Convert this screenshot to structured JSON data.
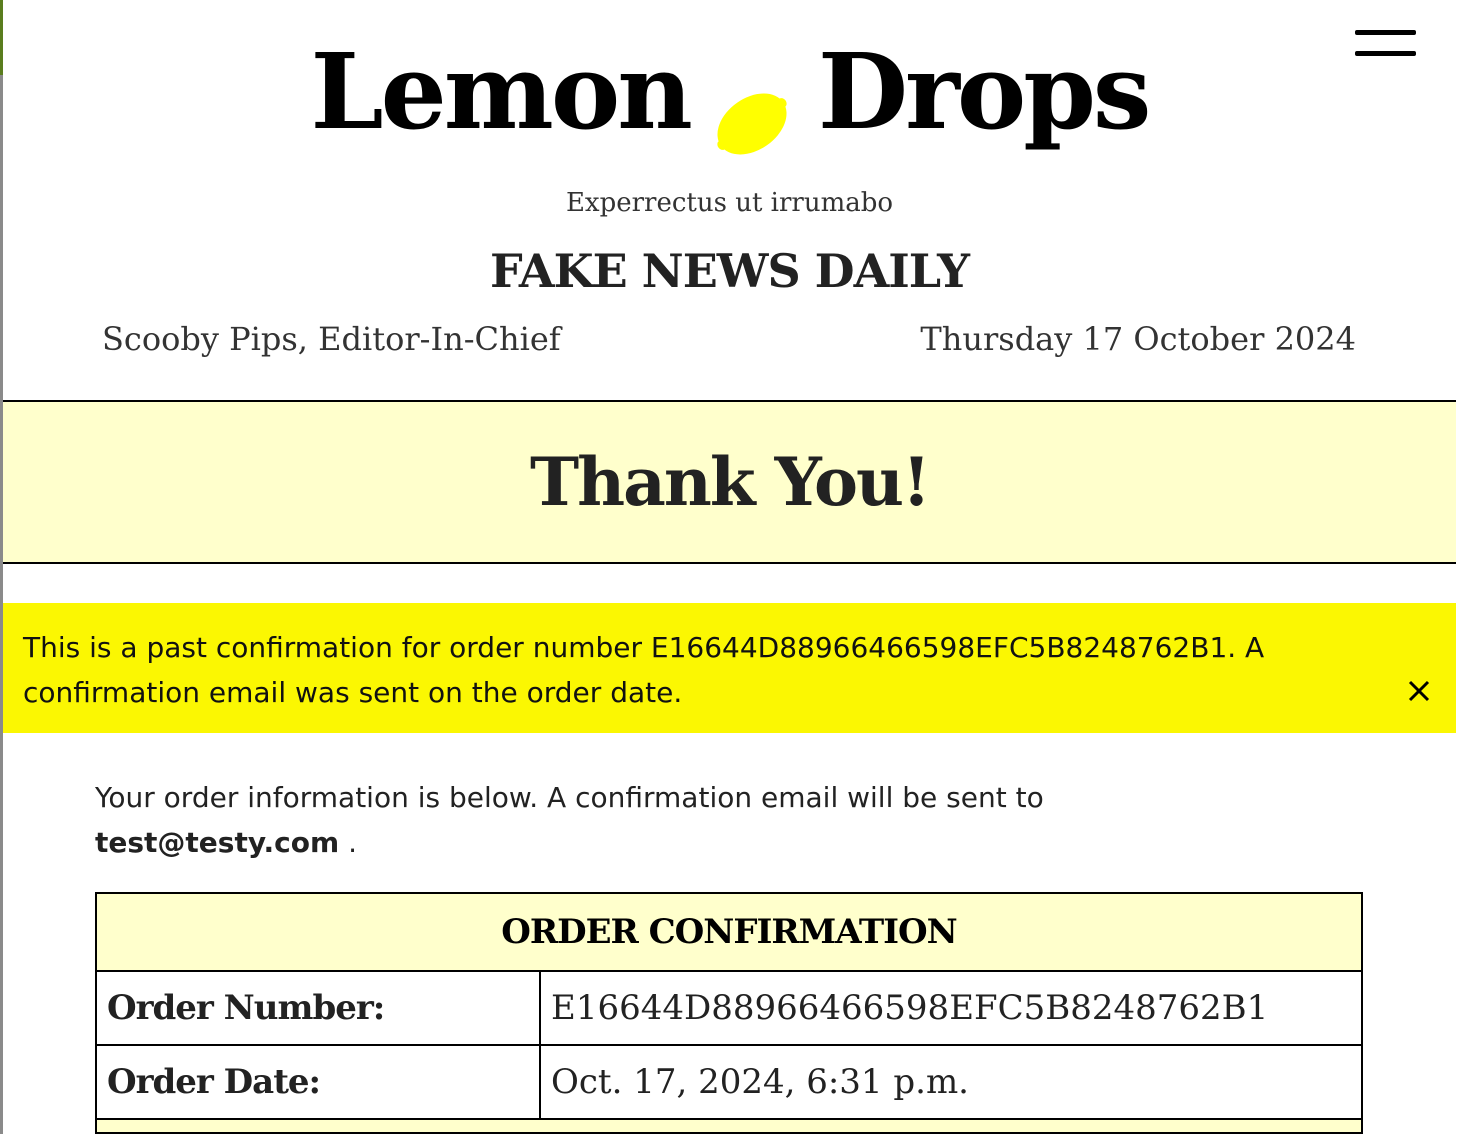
{
  "header": {
    "brand_left": "Lemon",
    "brand_right": "Drops",
    "lemon_icon": "lemon-icon",
    "menu_icon": "hamburger-icon",
    "tagline": "Experrectus ut irrumabo",
    "paper_name": "FAKE NEWS DAILY",
    "editor": "Scooby Pips, Editor-In-Chief",
    "date": "Thursday 17 October 2024"
  },
  "hero": {
    "title": "Thank You!"
  },
  "alert": {
    "message": "This is a past confirmation for order number E16644D88966466598EFC5B8248762B1. A confirmation email was sent on the order date.",
    "close_icon": "close-icon"
  },
  "intro": {
    "text": "Your order information is below. A confirmation email will be sent to",
    "email": "test@testy.com",
    "suffix": " ."
  },
  "order": {
    "heading": "ORDER CONFIRMATION",
    "rows": [
      {
        "label": "Order Number:",
        "value": "E16644D88966466598EFC5B8248762B1"
      },
      {
        "label": "Order Date:",
        "value": "Oct. 17, 2024, 6:31 p.m."
      }
    ]
  },
  "colors": {
    "banner_yellow": "#ffffcc",
    "alert_yellow": "#fbf702",
    "lemon": "#ffff00"
  }
}
